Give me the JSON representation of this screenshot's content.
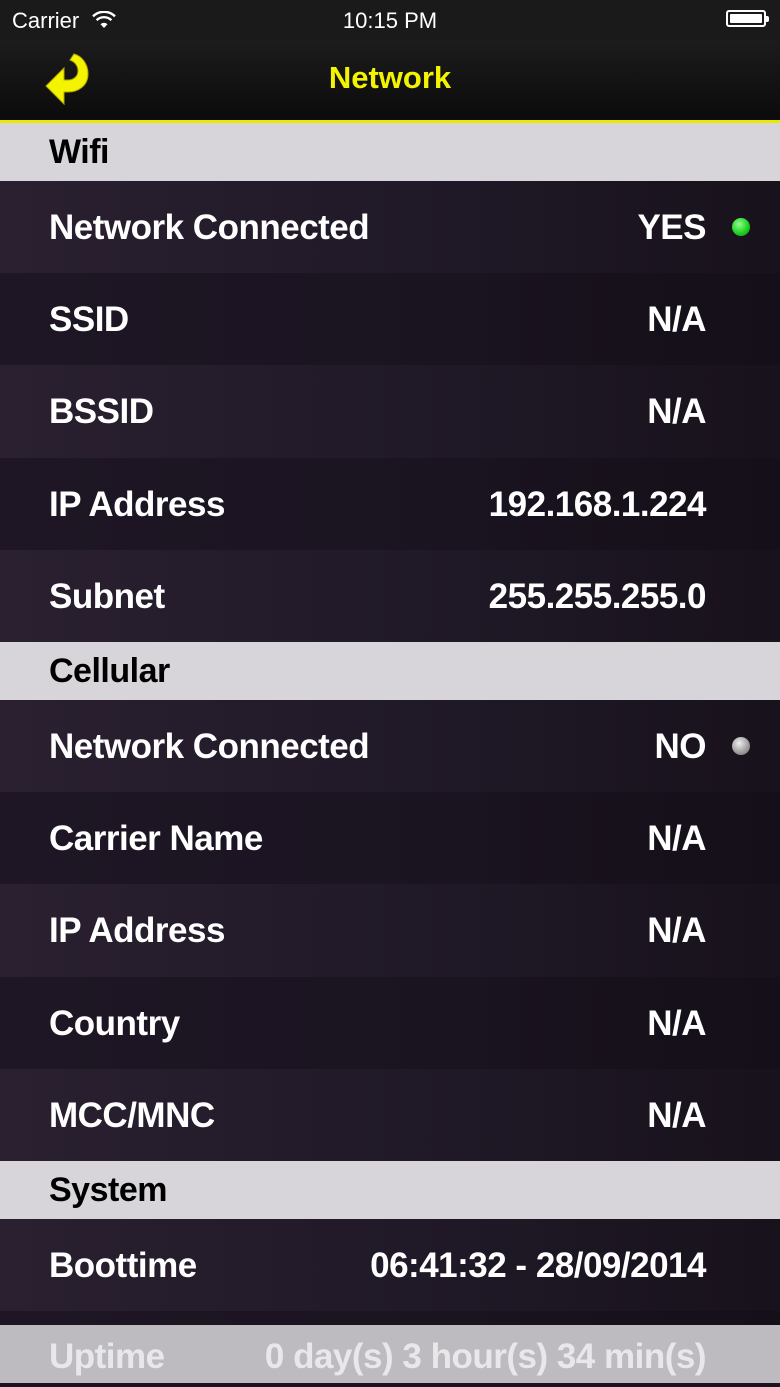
{
  "status_bar": {
    "carrier": "Carrier",
    "time": "10:15 PM",
    "wifi_icon": "wifi-icon",
    "battery_icon": "battery-icon"
  },
  "nav": {
    "title": "Network",
    "back_icon": "back-arrow-icon",
    "accent_color": "#f4f400"
  },
  "wifi": {
    "header": "Wifi",
    "rows": [
      {
        "label": "Network Connected",
        "value": "YES",
        "status": "green"
      },
      {
        "label": "SSID",
        "value": "N/A"
      },
      {
        "label": "BSSID",
        "value": "N/A"
      },
      {
        "label": "IP Address",
        "value": "192.168.1.224"
      },
      {
        "label": "Subnet",
        "value": "255.255.255.0"
      }
    ]
  },
  "cellular": {
    "header": "Cellular",
    "rows": [
      {
        "label": "Network Connected",
        "value": "NO",
        "status": "grey"
      },
      {
        "label": "Carrier Name",
        "value": "N/A"
      },
      {
        "label": "IP Address",
        "value": "N/A"
      },
      {
        "label": "Country",
        "value": "N/A"
      },
      {
        "label": "MCC/MNC",
        "value": "N/A"
      }
    ]
  },
  "system": {
    "header": "System",
    "rows": [
      {
        "label": "Boottime",
        "value": "06:41:32 - 28/09/2014"
      },
      {
        "label": "Uptime",
        "value": "0 day(s) 3 hour(s) 34 min(s)"
      }
    ]
  }
}
